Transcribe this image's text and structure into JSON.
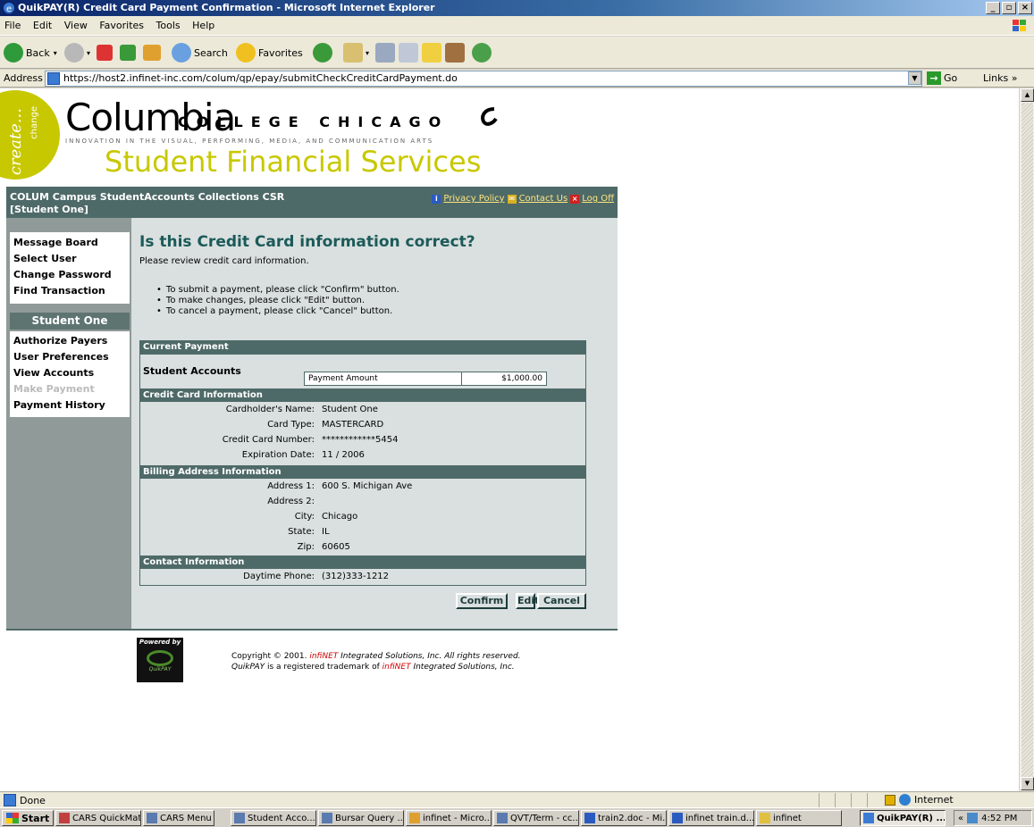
{
  "window": {
    "title": "QuikPAY(R) Credit Card Payment Confirmation - Microsoft Internet Explorer",
    "controls": [
      "_",
      "\b",
      "X"
    ]
  },
  "menu": [
    "File",
    "Edit",
    "View",
    "Favorites",
    "Tools",
    "Help"
  ],
  "toolbar": {
    "back": "Back",
    "search": "Search",
    "favorites": "Favorites"
  },
  "address": {
    "label": "Address",
    "url": "https://host2.infinet-inc.com/colum/qp/epay/submitCheckCreditCardPayment.do",
    "go": "Go",
    "links": "Links"
  },
  "header": {
    "create": "create...",
    "change": "change",
    "college_name": "Columbia",
    "college_sub": "COLLEGE CHICAGO",
    "tagline": "INNOVATION IN THE VISUAL, PERFORMING, MEDIA, AND COMMUNICATION ARTS",
    "department": "Student Financial Services"
  },
  "userbar": {
    "who": "COLUM Campus StudentAccounts Collections CSR [Student One]",
    "privacy": "Privacy Policy",
    "contact": "Contact Us",
    "logoff": "Log Off"
  },
  "nav": {
    "group1": [
      "Message Board",
      "Select User",
      "Change Password",
      "Find Transaction"
    ],
    "student_heading": "Student One",
    "group2": [
      "Authorize Payers",
      "User Preferences",
      "View Accounts",
      "Make Payment",
      "Payment History"
    ]
  },
  "main": {
    "title": "Is this Credit Card information correct?",
    "intro": "Please review credit card information.",
    "instructions": [
      "To submit a payment, please click \"Confirm\" button.",
      "To make changes, please click \"Edit\" button.",
      "To cancel a payment, please click \"Cancel\" button."
    ],
    "current_payment": {
      "heading": "Current Payment",
      "account": "Student Accounts",
      "amount_label": "Payment Amount",
      "amount": "$1,000.00"
    },
    "credit_card": {
      "heading": "Credit Card Information",
      "name_label": "Cardholder's Name:",
      "name": "Student One",
      "type_label": "Card Type:",
      "type": "MASTERCARD",
      "number_label": "Credit Card Number:",
      "number": "************5454",
      "exp_label": "Expiration Date:",
      "exp": "11 / 2006"
    },
    "billing": {
      "heading": "Billing Address Information",
      "addr1_label": "Address 1:",
      "addr1": "600 S. Michigan Ave",
      "addr2_label": "Address 2:",
      "addr2": "",
      "city_label": "City:",
      "city": "Chicago",
      "state_label": "State:",
      "state": "IL",
      "zip_label": "Zip:",
      "zip": "60605"
    },
    "contact": {
      "heading": "Contact Information",
      "phone_label": "Daytime Phone:",
      "phone": "(312)333-1212"
    },
    "buttons": {
      "confirm": "Confirm",
      "edit": "Edit",
      "cancel": "Cancel"
    }
  },
  "footer": {
    "powered_by": "Powered by",
    "powered_product": "QuikPAY",
    "copyright_a": "Copyright © 2001. ",
    "infinet1": "infiNET",
    "copyright_b": " Integrated Solutions, Inc. All rights reserved.",
    "quikpay": "QuikPAY",
    "copyright_c": " is a registered trademark of ",
    "infinet2": "infiNET",
    "copyright_d": " Integrated Solutions, Inc."
  },
  "status": {
    "text": "Done",
    "zone": "Internet"
  },
  "taskbar": {
    "start": "Start",
    "items": [
      "CARS QuickMate",
      "CARS Menu",
      "Student Acco...",
      "Bursar Query ...",
      "infinet - Micro...",
      "QVT/Term - cc...",
      "train2.doc - Mi...",
      "infinet train.d...",
      "infinet",
      "QuikPAY(R) ..."
    ],
    "time": "4:52 PM"
  }
}
